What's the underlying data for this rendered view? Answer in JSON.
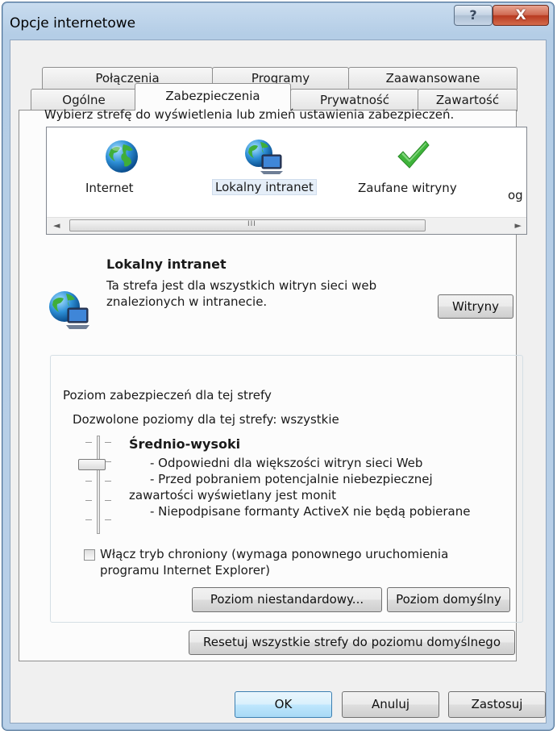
{
  "window": {
    "title": "Opcje internetowe",
    "help_glyph": "?",
    "close_glyph": "X"
  },
  "tabs": {
    "back_row": [
      "Połączenia",
      "Programy",
      "Zaawansowane"
    ],
    "front_row": [
      "Ogólne",
      "Zabezpieczenia",
      "Prywatność",
      "Zawartość"
    ],
    "active": "Zabezpieczenia"
  },
  "zones": {
    "instruction": "Wybierz strefę do wyświetlenia lub zmień ustawienia zabezpieczeń.",
    "items": [
      {
        "label": "Internet",
        "icon": "globe-icon"
      },
      {
        "label": "Lokalny intranet",
        "icon": "intranet-icon",
        "selected": true
      },
      {
        "label": "Zaufane witryny",
        "icon": "checkmark-icon"
      },
      {
        "label": "og",
        "icon": "none"
      }
    ],
    "scroll_left": "◄",
    "scroll_right": "►",
    "scroll_grip": "III"
  },
  "selected_zone": {
    "title": "Lokalny intranet",
    "description": "Ta strefa jest dla wszystkich witryn sieci web znalezionych w intranecie.",
    "sites_button": "Witryny"
  },
  "security_level": {
    "group_title": "Poziom zabezpieczeń dla tej strefy",
    "allowed": "Dozwolone poziomy dla tej strefy: wszystkie",
    "level_name": "Średnio-wysoki",
    "level_index_from_top": 1,
    "level_count": 5,
    "lines": [
      "- Odpowiedni dla większości witryn sieci Web",
      "- Przed pobraniem potencjalnie niebezpiecznej",
      "zawartości wyświetlany jest monit",
      "- Niepodpisane formanty ActiveX nie będą pobierane"
    ],
    "protected_mode_label": "Włącz tryb chroniony (wymaga ponownego uruchomienia programu Internet Explorer)",
    "protected_mode_checked": false,
    "custom_button": "Poziom niestandardowy...",
    "default_button": "Poziom domyślny"
  },
  "reset_button": "Resetuj wszystkie strefy do poziomu domyślnego",
  "footer": {
    "ok": "OK",
    "cancel": "Anuluj",
    "apply": "Zastosuj"
  }
}
